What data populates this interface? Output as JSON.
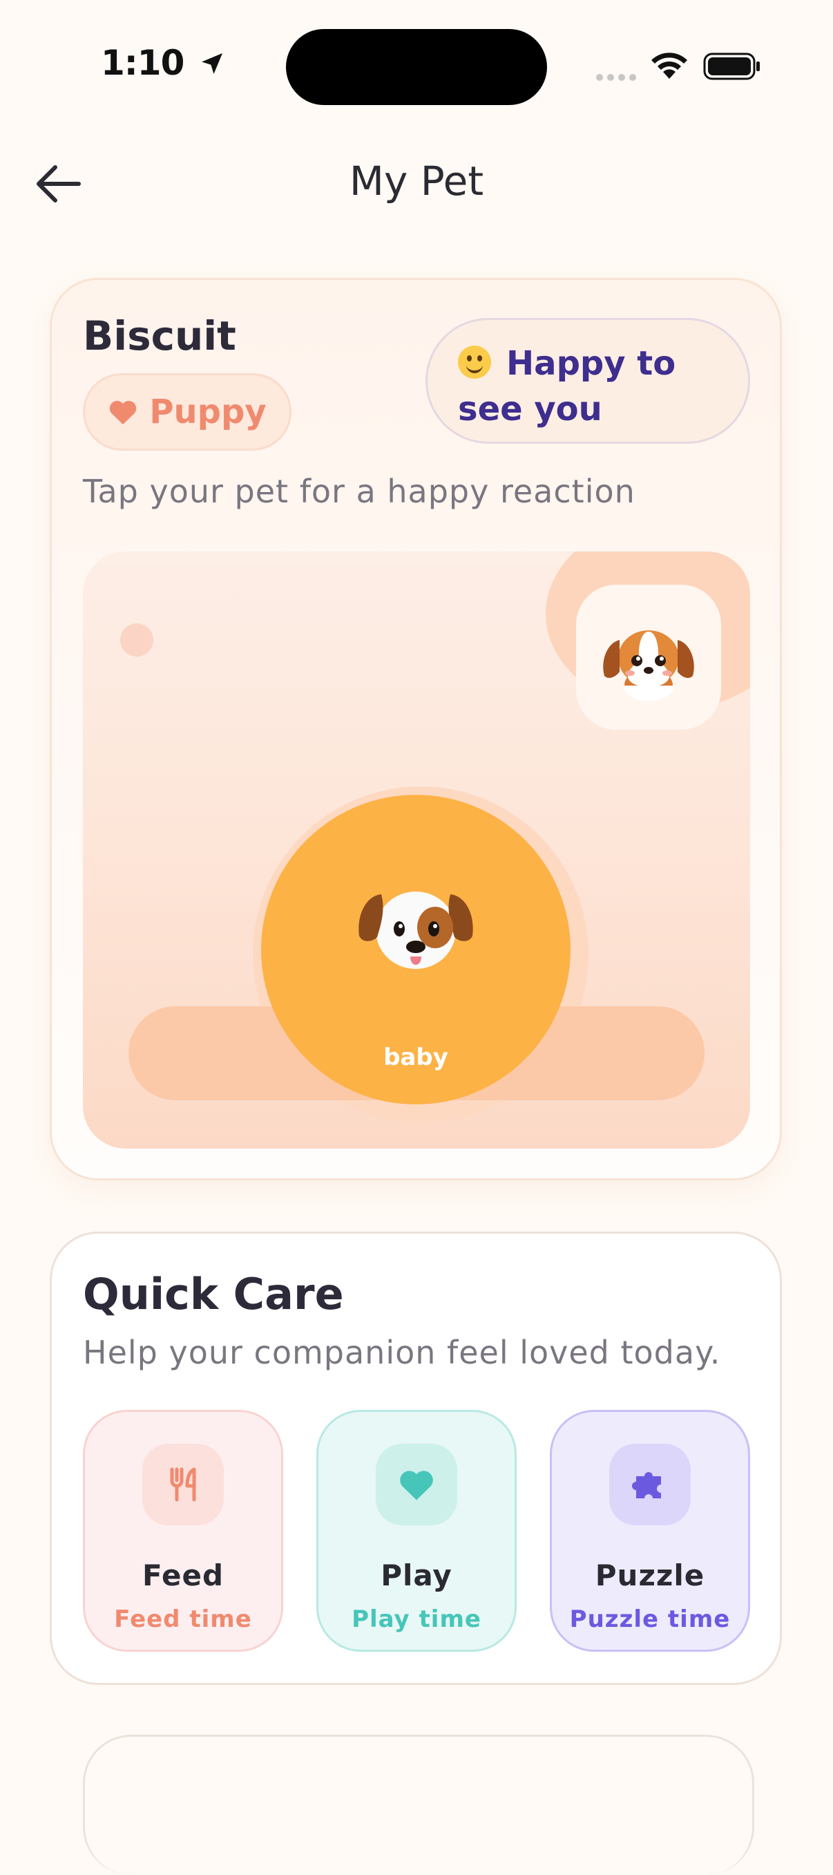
{
  "status_bar": {
    "time": "1:10"
  },
  "header": {
    "title": "My Pet"
  },
  "pet": {
    "name": "Biscuit",
    "type": "Puppy",
    "mood": "Happy to see you",
    "hint": "Tap your pet for a happy reaction",
    "stage_label": "baby"
  },
  "quick_care": {
    "title": "Quick Care",
    "subtitle": "Help your companion feel loved today.",
    "actions": [
      {
        "label": "Feed",
        "caption": "Feed time",
        "icon": "utensils-icon",
        "color": "#f08a6f"
      },
      {
        "label": "Play",
        "caption": "Play time",
        "icon": "heart-icon",
        "color": "#46c6b8"
      },
      {
        "label": "Puzzle",
        "caption": "Puzzle time",
        "icon": "puzzle-icon",
        "color": "#6b5ae0"
      }
    ]
  },
  "colors": {
    "orb": "#fdb246",
    "accent": "#f08a6f",
    "mood_text": "#3e2e8e"
  }
}
